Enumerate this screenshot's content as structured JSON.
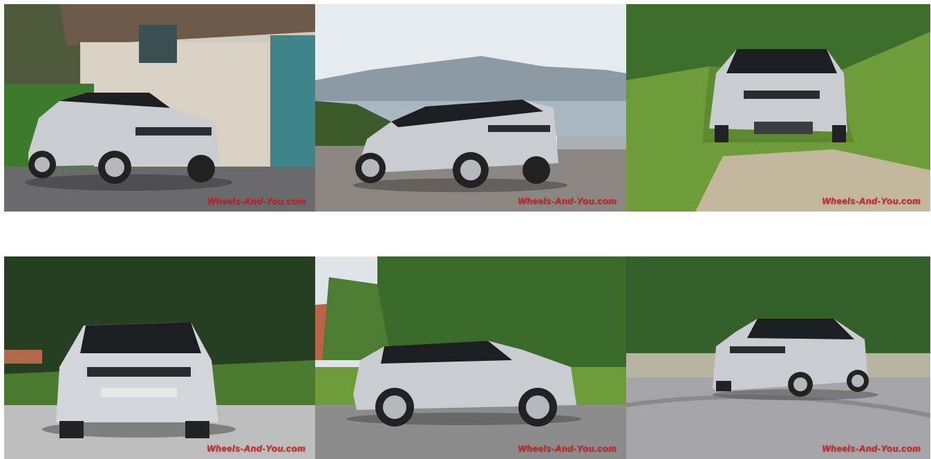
{
  "gallery": {
    "watermark_text": "Wheels-And-You.com",
    "colors": {
      "watermark": "#d9252a",
      "car_silver": "#c9ccd1",
      "car_roof": "#1c1e22",
      "foliage": "#3f6b2a",
      "grass": "#6f9c3a",
      "road": "#8c8c8c",
      "sky": "#e6ebef"
    },
    "photos": [
      {
        "scene": "silver-suv-front-three-quarter-by-old-stone-building"
      },
      {
        "scene": "silver-suv-rear-three-quarter-mountain-lake-view"
      },
      {
        "scene": "silver-suv-front-on-grassy-hill-path"
      },
      {
        "scene": "silver-suv-front-under-trees"
      },
      {
        "scene": "silver-suv-side-profile-driving"
      },
      {
        "scene": "silver-suv-cornering-on-mountain-road"
      }
    ]
  }
}
